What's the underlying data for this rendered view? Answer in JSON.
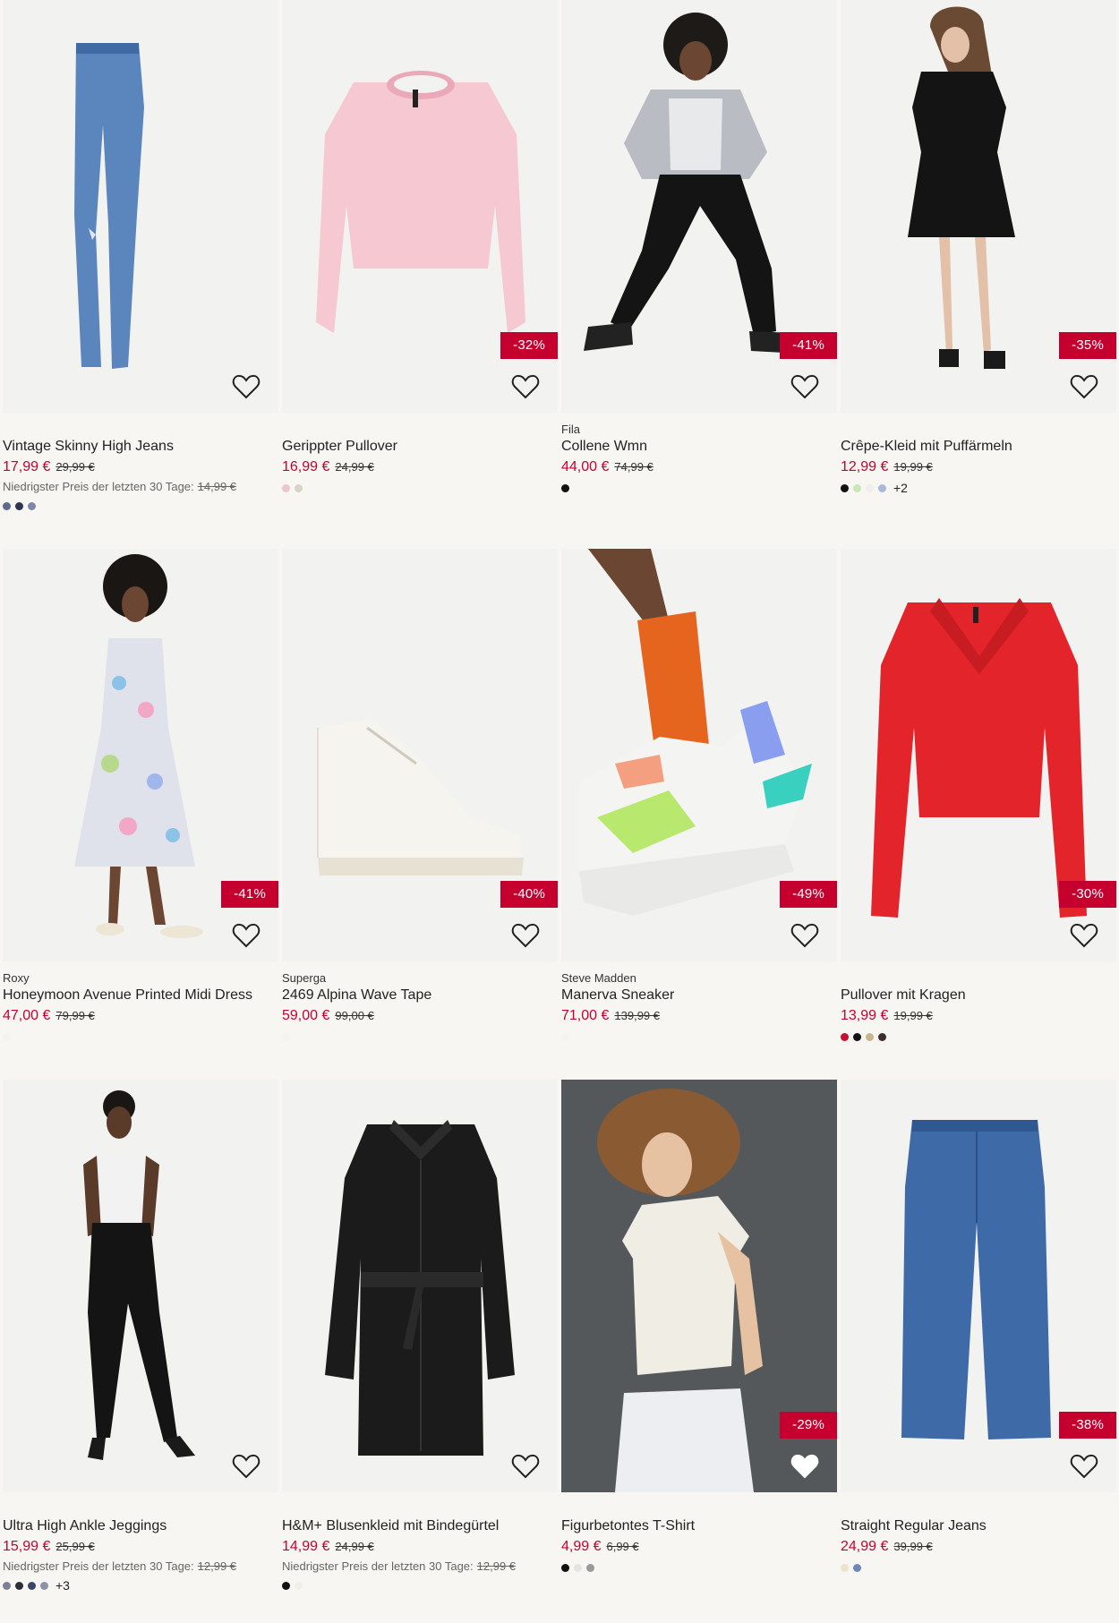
{
  "products": [
    {
      "brand": "",
      "title": "Vintage Skinny High Jeans",
      "price": "17,99 €",
      "old": "29,99 €",
      "lowest_label": "Niedrigster Preis der letzten 30 Tage:",
      "lowest_price": "14,99 €",
      "badge": "",
      "swatches": [
        "#5e6b8c",
        "#2d3550",
        "#7b88a6"
      ],
      "more": "",
      "icon": "jeans-product-image"
    },
    {
      "brand": "",
      "title": "Gerippter Pullover",
      "price": "16,99 €",
      "old": "24,99 €",
      "lowest_label": "",
      "lowest_price": "",
      "badge": "-32%",
      "swatches": [
        "#e9c7cf",
        "#d9d3c2"
      ],
      "more": "",
      "icon": "pink-pullover-product-image"
    },
    {
      "brand": "Fila",
      "title": "Collene Wmn",
      "price": "44,00 €",
      "old": "74,99 €",
      "lowest_label": "",
      "lowest_price": "",
      "badge": "-41%",
      "swatches": [
        "#111111"
      ],
      "more": "",
      "icon": "sneaker-model-product-image"
    },
    {
      "brand": "",
      "title": "Crêpe-Kleid mit Puffärmeln",
      "price": "12,99 €",
      "old": "19,99 €",
      "lowest_label": "",
      "lowest_price": "",
      "badge": "-35%",
      "swatches": [
        "#111111",
        "#c9e7b4",
        "#f0efe9",
        "#a9b9d9"
      ],
      "more": "+2",
      "icon": "black-dress-product-image"
    },
    {
      "brand": "Roxy",
      "title": "Honeymoon Avenue Printed Midi Dress",
      "price": "47,00 €",
      "old": "79,99 €",
      "lowest_label": "",
      "lowest_price": "",
      "badge": "-41%",
      "swatches": [
        "#f3f3f3"
      ],
      "more": "",
      "icon": "floral-dress-product-image"
    },
    {
      "brand": "Superga",
      "title": "2469 Alpina Wave Tape",
      "price": "59,00 €",
      "old": "99,00 €",
      "lowest_label": "",
      "lowest_price": "",
      "badge": "-40%",
      "swatches": [
        "#f3f3f3"
      ],
      "more": "",
      "icon": "white-sneaker-product-image"
    },
    {
      "brand": "Steve Madden",
      "title": "Manerva Sneaker",
      "price": "71,00 €",
      "old": "139,99 €",
      "lowest_label": "",
      "lowest_price": "",
      "badge": "-49%",
      "swatches": [
        "#f3f3f3"
      ],
      "more": "",
      "icon": "chunky-sneaker-product-image"
    },
    {
      "brand": "",
      "title": "Pullover mit Kragen",
      "price": "13,99 €",
      "old": "19,99 €",
      "lowest_label": "",
      "lowest_price": "",
      "badge": "-30%",
      "swatches": [
        "#c8102e",
        "#111111",
        "#c8b58a",
        "#3b2f2a"
      ],
      "more": "",
      "icon": "red-pullover-product-image"
    },
    {
      "brand": "",
      "title": "Ultra High Ankle Jeggings",
      "price": "15,99 €",
      "old": "25,99 €",
      "lowest_label": "Niedrigster Preis der letzten 30 Tage:",
      "lowest_price": "12,99 €",
      "badge": "",
      "swatches": [
        "#7a8194",
        "#2b2f3a",
        "#3b4766",
        "#8a93a8"
      ],
      "more": "+3",
      "icon": "jeggings-model-product-image"
    },
    {
      "brand": "",
      "title": "H&M+ Blusenkleid mit Bindegürtel",
      "price": "14,99 €",
      "old": "24,99 €",
      "lowest_label": "Niedrigster Preis der letzten 30 Tage:",
      "lowest_price": "12,99 €",
      "badge": "",
      "swatches": [
        "#111111",
        "#f0efe9"
      ],
      "more": "",
      "icon": "shirt-dress-product-image"
    },
    {
      "brand": "",
      "title": "Figurbetontes T-Shirt",
      "price": "4,99 €",
      "old": "6,99 €",
      "lowest_label": "",
      "lowest_price": "",
      "badge": "-29%",
      "swatches": [
        "#111111",
        "#e6e4de",
        "#9a9a9a"
      ],
      "more": "",
      "icon": "tshirt-model-product-image"
    },
    {
      "brand": "",
      "title": "Straight Regular Jeans",
      "price": "24,99 €",
      "old": "39,99 €",
      "lowest_label": "",
      "lowest_price": "",
      "badge": "-38%",
      "swatches": [
        "#e9e3cf",
        "#6f87b8"
      ],
      "more": "",
      "icon": "straight-jeans-product-image"
    }
  ]
}
